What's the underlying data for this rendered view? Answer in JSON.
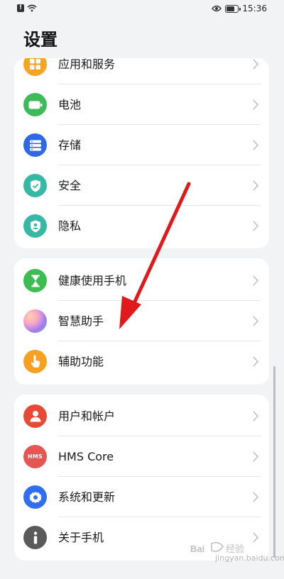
{
  "status_bar": {
    "time": "15:36",
    "notification_glyph": "!"
  },
  "header": {
    "title": "设置"
  },
  "groups": [
    {
      "items": [
        {
          "label": "应用和服务",
          "icon": "apps-icon",
          "color": "#f7a325"
        },
        {
          "label": "电池",
          "icon": "battery-icon",
          "color": "#3dbb5b"
        },
        {
          "label": "存储",
          "icon": "storage-icon",
          "color": "#2c68e8"
        },
        {
          "label": "安全",
          "icon": "shield-icon",
          "color": "#36b8a4"
        },
        {
          "label": "隐私",
          "icon": "privacy-icon",
          "color": "#36b8a4"
        }
      ]
    },
    {
      "items": [
        {
          "label": "健康使用手机",
          "icon": "hourglass-icon",
          "color": "#3cbd52"
        },
        {
          "label": "智慧助手",
          "icon": "assistant-orb-icon",
          "color": "#9d7cf2"
        },
        {
          "label": "辅助功能",
          "icon": "hand-pointer-icon",
          "color": "#f5a020"
        }
      ]
    },
    {
      "items": [
        {
          "label": "用户和帐户",
          "icon": "user-icon",
          "color": "#e64a35"
        },
        {
          "label": "HMS Core",
          "icon": "hms-icon",
          "color": "#e45554",
          "badge": "HMS"
        },
        {
          "label": "系统和更新",
          "icon": "gear-icon",
          "color": "#2f6ef0"
        },
        {
          "label": "关于手机",
          "icon": "info-icon",
          "color": "#5a5a5a"
        }
      ]
    }
  ],
  "watermark": {
    "text": "jingyan.baidu.com"
  },
  "annotation_arrow_color": "#e0191b"
}
